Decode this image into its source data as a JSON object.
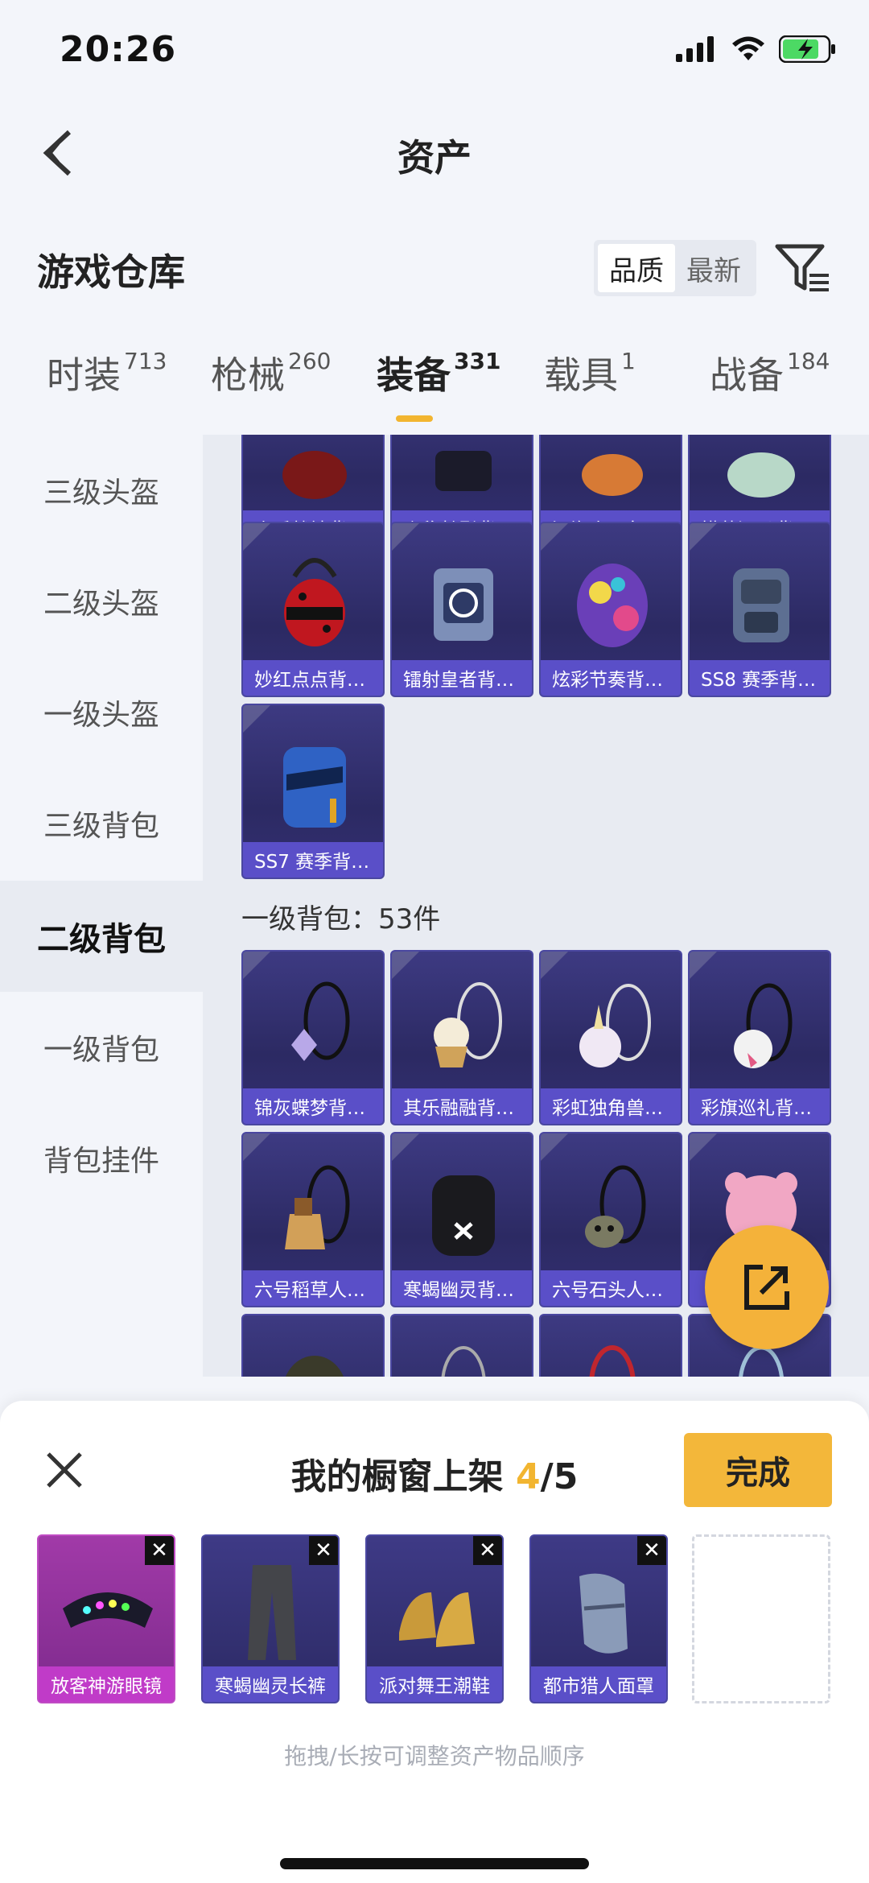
{
  "status_bar": {
    "time": "20:26"
  },
  "nav": {
    "title": "资产"
  },
  "header": {
    "repo_title": "游戏仓库",
    "sort_options": [
      "品质",
      "最新"
    ],
    "sort_active": "品质"
  },
  "tabs": [
    {
      "label": "时装",
      "count": "713"
    },
    {
      "label": "枪械",
      "count": "260"
    },
    {
      "label": "装备",
      "count": "331"
    },
    {
      "label": "载具",
      "count": "1"
    },
    {
      "label": "战备",
      "count": "184"
    }
  ],
  "sidebar": {
    "items": [
      "三级头盔",
      "二级头盔",
      "一级头盔",
      "三级背包",
      "二级背包",
      "一级背包",
      "背包挂件"
    ],
    "active": "二级背包"
  },
  "content": {
    "row_top": [
      "炎氏战神背…",
      "幽秘魅影背…",
      "深海小丑鱼…",
      "懵萌河马背…"
    ],
    "row_2": [
      "妙红点点背…",
      "镭射皇者背…",
      "炫彩节奏背…",
      "SS8 赛季背…"
    ],
    "row_3": [
      "SS7 赛季背…"
    ],
    "section_level1": "一级背包：53件",
    "row_4": [
      "锦灰蝶梦背…",
      "其乐融融背…",
      "彩虹独角兽…",
      "彩旗巡礼背…"
    ],
    "row_5": [
      "六号稻草人…",
      "寒蝎幽灵背…",
      "六号石头人…",
      ""
    ]
  },
  "sheet": {
    "title_prefix": "我的橱窗上架",
    "title_current": "4",
    "title_total": "/5",
    "done_label": "完成",
    "slots": [
      "放客神游眼镜",
      "寒蝎幽灵长裤",
      "派对舞王潮鞋",
      "都市猎人面罩"
    ],
    "hint": "拖拽/长按可调整资产物品顺序"
  },
  "colors": {
    "accent": "#f2b530",
    "card_label": "#5a4fc8",
    "card_bg": "#2c2a63"
  }
}
